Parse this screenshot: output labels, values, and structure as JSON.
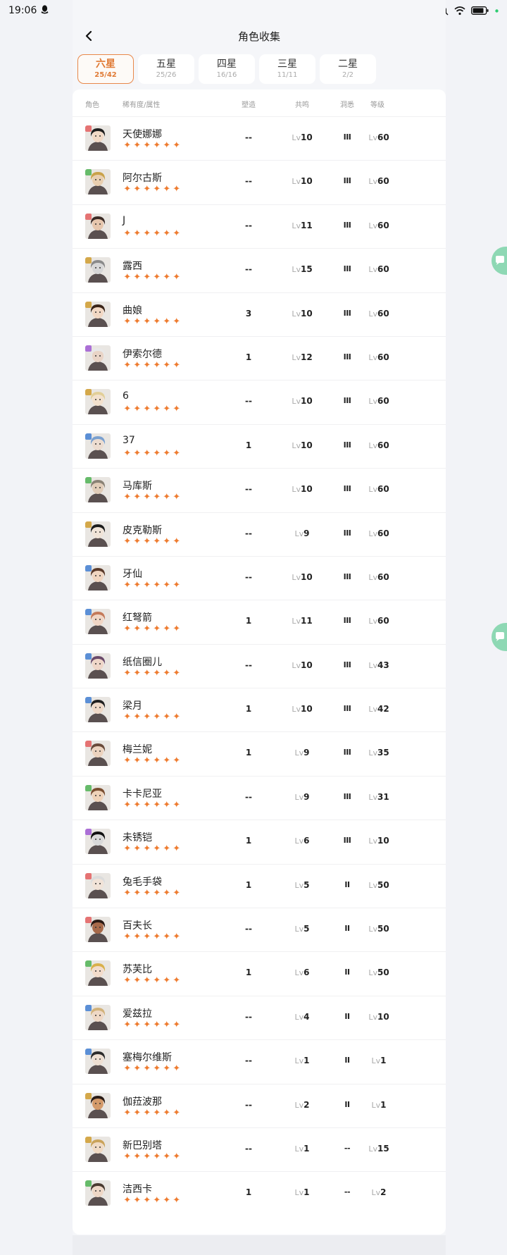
{
  "status_bar": {
    "time": "19:06"
  },
  "header": {
    "title": "角色收集"
  },
  "tabs": [
    {
      "label": "六星",
      "count": "25/42",
      "active": true
    },
    {
      "label": "五星",
      "count": "25/26",
      "active": false
    },
    {
      "label": "四星",
      "count": "16/16",
      "active": false
    },
    {
      "label": "三星",
      "count": "11/11",
      "active": false
    },
    {
      "label": "二星",
      "count": "2/2",
      "active": false
    }
  ],
  "columns": {
    "role": "角色",
    "rarity": "稀有度/属性",
    "suzao": "塑造",
    "gongming": "共鸣",
    "dongxi": "洞悉",
    "level": "等级"
  },
  "lv_prefix": "Lv",
  "rows": [
    {
      "name": "天使娜娜",
      "suzao": "--",
      "gongming": "10",
      "dongxi": "III",
      "level": "60",
      "badge_color": "#e57373",
      "hair": "#1f1f1f",
      "skin": "#f1d9c6",
      "stars": 6
    },
    {
      "name": "阿尔古斯",
      "suzao": "--",
      "gongming": "10",
      "dongxi": "III",
      "level": "60",
      "badge_color": "#66bb6a",
      "hair": "#c9a24a",
      "skin": "#e9cfb0",
      "stars": 6
    },
    {
      "name": "J",
      "suzao": "--",
      "gongming": "11",
      "dongxi": "III",
      "level": "60",
      "badge_color": "#e57373",
      "hair": "#3a2b26",
      "skin": "#e6c6ad",
      "stars": 6
    },
    {
      "name": "露西",
      "suzao": "--",
      "gongming": "15",
      "dongxi": "III",
      "level": "60",
      "badge_color": "#d4a84a",
      "hair": "#8a8a8a",
      "skin": "#d7d7d7",
      "stars": 6
    },
    {
      "name": "曲娘",
      "suzao": "3",
      "gongming": "10",
      "dongxi": "III",
      "level": "60",
      "badge_color": "#d4a84a",
      "hair": "#3a2418",
      "skin": "#f2d8c4",
      "stars": 6
    },
    {
      "name": "伊索尔德",
      "suzao": "1",
      "gongming": "12",
      "dongxi": "III",
      "level": "60",
      "badge_color": "#ab6fd6",
      "hair": "#e8e8e8",
      "skin": "#e9d4c6",
      "stars": 6
    },
    {
      "name": "6",
      "suzao": "--",
      "gongming": "10",
      "dongxi": "III",
      "level": "60",
      "badge_color": "#d4a84a",
      "hair": "#e2cf98",
      "skin": "#f3e1cd",
      "stars": 6
    },
    {
      "name": "37",
      "suzao": "1",
      "gongming": "10",
      "dongxi": "III",
      "level": "60",
      "badge_color": "#5b8fd6",
      "hair": "#7aa0cf",
      "skin": "#ecdcd0",
      "stars": 6
    },
    {
      "name": "马库斯",
      "suzao": "--",
      "gongming": "10",
      "dongxi": "III",
      "level": "60",
      "badge_color": "#66bb6a",
      "hair": "#8a8275",
      "skin": "#e1cdb9",
      "stars": 6
    },
    {
      "name": "皮克勒斯",
      "suzao": "--",
      "gongming": "9",
      "dongxi": "III",
      "level": "60",
      "badge_color": "#d4a84a",
      "hair": "#1c1c1c",
      "skin": "#f0e4d8",
      "stars": 6
    },
    {
      "name": "牙仙",
      "suzao": "--",
      "gongming": "10",
      "dongxi": "III",
      "level": "60",
      "badge_color": "#5b8fd6",
      "hair": "#5a3a2a",
      "skin": "#f0d5c0",
      "stars": 6
    },
    {
      "name": "红弩箭",
      "suzao": "1",
      "gongming": "11",
      "dongxi": "III",
      "level": "60",
      "badge_color": "#5b8fd6",
      "hair": "#c47a5a",
      "skin": "#f1d6c5",
      "stars": 6
    },
    {
      "name": "纸信圈儿",
      "suzao": "--",
      "gongming": "10",
      "dongxi": "III",
      "level": "43",
      "badge_color": "#5b8fd6",
      "hair": "#6a4a6a",
      "skin": "#efd6c8",
      "stars": 6
    },
    {
      "name": "梁月",
      "suzao": "1",
      "gongming": "10",
      "dongxi": "III",
      "level": "42",
      "badge_color": "#5b8fd6",
      "hair": "#202020",
      "skin": "#efd9c8",
      "stars": 6
    },
    {
      "name": "梅兰妮",
      "suzao": "1",
      "gongming": "9",
      "dongxi": "III",
      "level": "35",
      "badge_color": "#e57373",
      "hair": "#6a4a3a",
      "skin": "#ecd3bf",
      "stars": 6
    },
    {
      "name": "卡卡尼亚",
      "suzao": "--",
      "gongming": "9",
      "dongxi": "III",
      "level": "31",
      "badge_color": "#66bb6a",
      "hair": "#7a4e30",
      "skin": "#efd2b8",
      "stars": 6
    },
    {
      "name": "未锈铠",
      "suzao": "1",
      "gongming": "6",
      "dongxi": "III",
      "level": "10",
      "badge_color": "#ab6fd6",
      "hair": "#111111",
      "skin": "#d9d9d9",
      "stars": 6
    },
    {
      "name": "兔毛手袋",
      "suzao": "1",
      "gongming": "5",
      "dongxi": "II",
      "level": "50",
      "badge_color": "#e57373",
      "hair": "#dcdcdc",
      "skin": "#f1e3d8",
      "stars": 6
    },
    {
      "name": "百夫长",
      "suzao": "--",
      "gongming": "5",
      "dongxi": "II",
      "level": "50",
      "badge_color": "#e57373",
      "hair": "#2a1a14",
      "skin": "#a86a4a",
      "stars": 6
    },
    {
      "name": "苏芙比",
      "suzao": "1",
      "gongming": "6",
      "dongxi": "II",
      "level": "50",
      "badge_color": "#66bb6a",
      "hair": "#d9b04a",
      "skin": "#f3dccb",
      "stars": 6
    },
    {
      "name": "爱兹拉",
      "suzao": "--",
      "gongming": "4",
      "dongxi": "II",
      "level": "10",
      "badge_color": "#5b8fd6",
      "hair": "#d2b27a",
      "skin": "#efd8c5",
      "stars": 6
    },
    {
      "name": "塞梅尔维斯",
      "suzao": "--",
      "gongming": "1",
      "dongxi": "II",
      "level": "1",
      "badge_color": "#5b8fd6",
      "hair": "#2c2c2c",
      "skin": "#eedfd2",
      "stars": 6
    },
    {
      "name": "伽菈波那",
      "suzao": "--",
      "gongming": "2",
      "dongxi": "II",
      "level": "1",
      "badge_color": "#d4a84a",
      "hair": "#2a1c16",
      "skin": "#d49a6a",
      "stars": 6
    },
    {
      "name": "新巴别塔",
      "suzao": "--",
      "gongming": "1",
      "dongxi": "--",
      "level": "15",
      "badge_color": "#d4a84a",
      "hair": "#caa35a",
      "skin": "#f0dac4",
      "stars": 6
    },
    {
      "name": "洁西卡",
      "suzao": "1",
      "gongming": "1",
      "dongxi": "--",
      "level": "2",
      "badge_color": "#66bb6a",
      "hair": "#4a3a30",
      "skin": "#eed7c6",
      "stars": 6
    }
  ]
}
